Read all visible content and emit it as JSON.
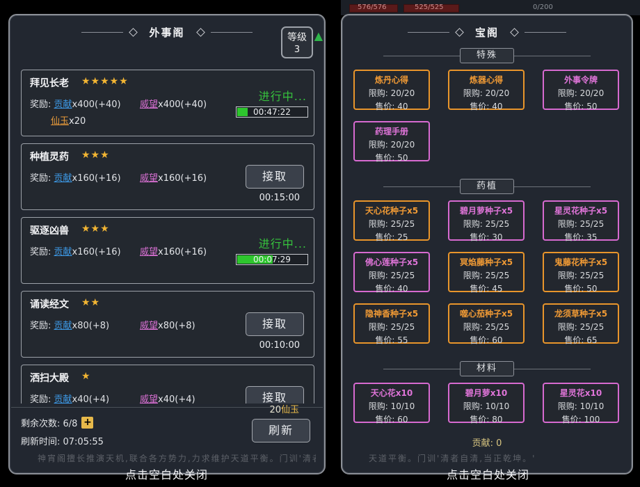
{
  "left": {
    "title": "外事阁",
    "level_label": "等级",
    "level_value": "3",
    "tasks": [
      {
        "name": "拜见长老",
        "stars": "★★★★★",
        "reward_label": "奖励:",
        "gx": "贡献",
        "gx_amt": "x400(+40)",
        "ww": "威望",
        "ww_amt": "x400(+40)",
        "xy": "仙玉",
        "xy_amt": "x20",
        "status": "进行中...",
        "progress": 0.15,
        "time": "00:47:22"
      },
      {
        "name": "种植灵药",
        "stars": "★★★",
        "reward_label": "奖励:",
        "gx": "贡献",
        "gx_amt": "x160(+16)",
        "ww": "威望",
        "ww_amt": "x160(+16)",
        "button": "接取",
        "time": "00:15:00"
      },
      {
        "name": "驱逐凶兽",
        "stars": "★★★",
        "reward_label": "奖励:",
        "gx": "贡献",
        "gx_amt": "x160(+16)",
        "ww": "威望",
        "ww_amt": "x160(+16)",
        "status": "进行中...",
        "progress": 0.5,
        "time": "00:07:29"
      },
      {
        "name": "诵读经文",
        "stars": "★★",
        "reward_label": "奖励:",
        "gx": "贡献",
        "gx_amt": "x80(+8)",
        "ww": "威望",
        "ww_amt": "x80(+8)",
        "button": "接取",
        "time": "00:10:00"
      },
      {
        "name": "洒扫大殿",
        "stars": "★",
        "reward_label": "奖励:",
        "gx": "贡献",
        "gx_amt": "x40(+4)",
        "ww": "威望",
        "ww_amt": "x40(+4)",
        "button": "接取",
        "time": ""
      }
    ],
    "remain_label": "剩余次数: 6/8",
    "refresh_label": "刷新时间: 07:05:55",
    "cost_amount": "20",
    "cost_unit": "仙玉",
    "refresh_button": "刷新",
    "close_hint": "点击空白处关闭"
  },
  "right": {
    "title": "宝阁",
    "sections": [
      {
        "label": "特殊",
        "items": [
          {
            "name": "炼丹心得",
            "limit": "限购: 20/20",
            "price": "售价: 40",
            "color": "orange"
          },
          {
            "name": "炼器心得",
            "limit": "限购: 20/20",
            "price": "售价: 40",
            "color": "orange"
          },
          {
            "name": "外事令牌",
            "limit": "限购: 20/20",
            "price": "售价: 50",
            "color": "purple"
          },
          {
            "name": "药理手册",
            "limit": "限购: 20/20",
            "price": "售价: 50",
            "color": "purple"
          }
        ]
      },
      {
        "label": "药植",
        "items": [
          {
            "name": "天心花种子x5",
            "limit": "限购: 25/25",
            "price": "售价: 25",
            "color": "orange"
          },
          {
            "name": "碧月萝种子x5",
            "limit": "限购: 25/25",
            "price": "售价: 30",
            "color": "purple"
          },
          {
            "name": "星灵花种子x5",
            "limit": "限购: 25/25",
            "price": "售价: 35",
            "color": "purple"
          },
          {
            "name": "佛心莲种子x5",
            "limit": "限购: 25/25",
            "price": "售价: 40",
            "color": "purple"
          },
          {
            "name": "冥焰藤种子x5",
            "limit": "限购: 25/25",
            "price": "售价: 45",
            "color": "orange"
          },
          {
            "name": "鬼藤花种子x5",
            "limit": "限购: 25/25",
            "price": "售价: 50",
            "color": "orange"
          },
          {
            "name": "隐神香种子x5",
            "limit": "限购: 25/25",
            "price": "售价: 55",
            "color": "orange"
          },
          {
            "name": "噬心茄种子x5",
            "limit": "限购: 25/25",
            "price": "售价: 60",
            "color": "orange"
          },
          {
            "name": "龙须草种子x5",
            "limit": "限购: 25/25",
            "price": "售价: 65",
            "color": "orange"
          }
        ]
      },
      {
        "label": "材料",
        "items": [
          {
            "name": "天心花x10",
            "limit": "限购: 10/10",
            "price": "售价: 60",
            "color": "purple"
          },
          {
            "name": "碧月萝x10",
            "limit": "限购: 10/10",
            "price": "售价: 80",
            "color": "purple"
          },
          {
            "name": "星灵花x10",
            "limit": "限购: 10/10",
            "price": "售价: 100",
            "color": "purple"
          }
        ]
      }
    ],
    "contribution": "贡献: 0",
    "close_hint": "点击空白处关闭"
  },
  "background": {
    "top_values": [
      "576/576",
      "525/525",
      "0/200"
    ],
    "bottom_text_left": "神宵阁擅长推演天机,联合各方势力,力求维护天道平衡。门训'清者自清,当正乾坤'",
    "bottom_text_right": "天道平衡。门训'清者自清,当正乾坤。'"
  },
  "colors": {
    "orange": "#e9952b",
    "purple": "#d76ad0",
    "green": "#2ec62e",
    "gold": "#e7b94a",
    "blue": "#3d9ae8"
  }
}
